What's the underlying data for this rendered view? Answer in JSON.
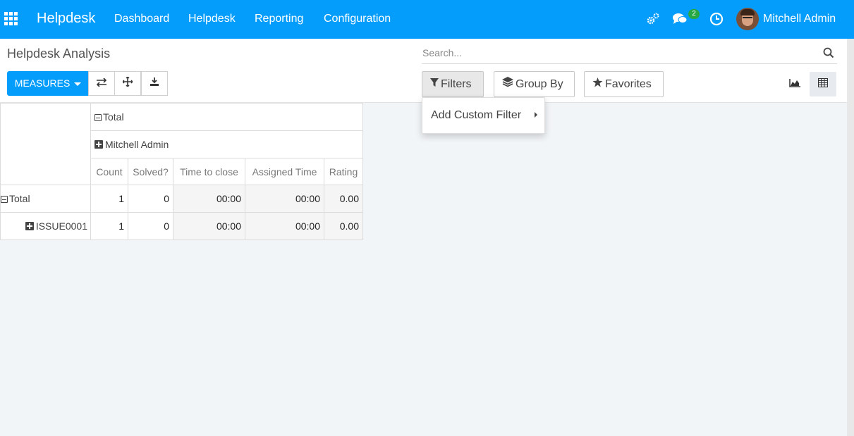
{
  "navbar": {
    "app_name": "Helpdesk",
    "menus": [
      "Dashboard",
      "Helpdesk",
      "Reporting",
      "Configuration"
    ],
    "messages_count": "2",
    "user_name": "Mitchell Admin",
    "icons": [
      "apps-grid-icon",
      "settings-gears-icon",
      "chat-icon",
      "clock-icon"
    ]
  },
  "breadcrumb": "Helpdesk Analysis",
  "toolbar": {
    "measures_label": "MEASURES",
    "icons": [
      "flip-axis-icon",
      "expand-all-icon",
      "download-icon"
    ]
  },
  "search": {
    "placeholder": "Search..."
  },
  "filters": {
    "filters_label": "Filters",
    "group_by_label": "Group By",
    "favorites_label": "Favorites"
  },
  "dropdown": {
    "add_custom_filter": "Add Custom Filter"
  },
  "views": [
    "graph-view-icon",
    "pivot-view-icon"
  ],
  "pivot": {
    "col_total": "Total",
    "col_group": "Mitchell Admin",
    "measures": [
      "Count",
      "Solved?",
      "Time to close",
      "Assigned Time",
      "Rating"
    ],
    "rows": [
      {
        "label": "Total",
        "values": [
          "1",
          "0",
          "00:00",
          "00:00",
          "0.00"
        ]
      },
      {
        "label": "ISSUE0001",
        "values": [
          "1",
          "0",
          "00:00",
          "00:00",
          "0.00"
        ]
      }
    ]
  },
  "colors": {
    "brand": "#049dfb",
    "badge": "#28a745"
  }
}
